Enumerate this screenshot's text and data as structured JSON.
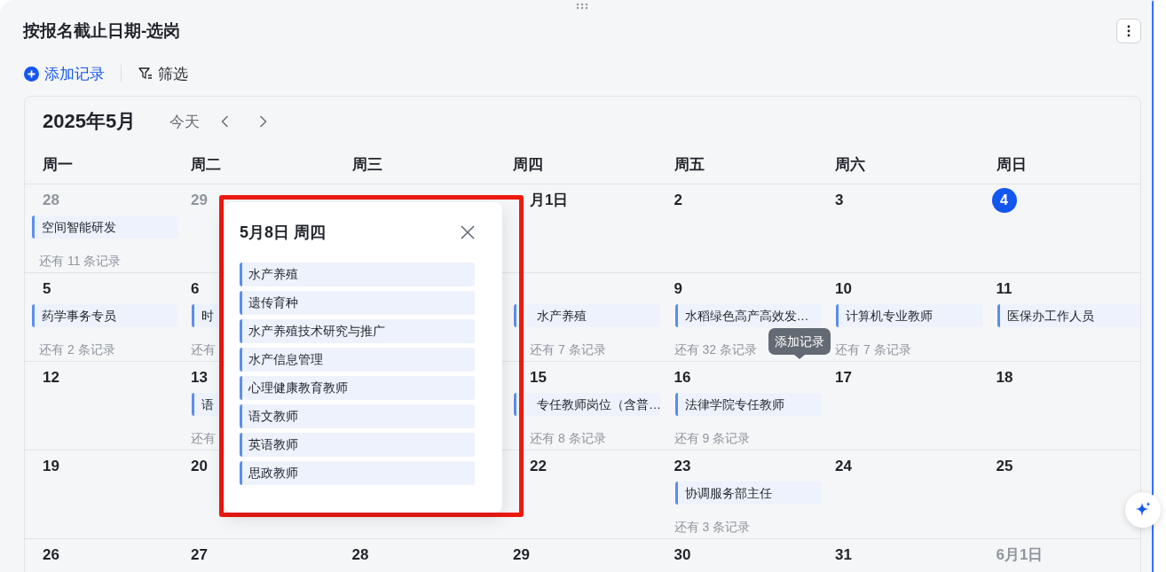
{
  "title": "按报名截止日期-选岗",
  "toolbar": {
    "add_label": "添加记录",
    "filter_label": "筛选"
  },
  "calendar": {
    "month_label": "2025年5月",
    "today_label": "今天",
    "weekdays": [
      "周一",
      "周二",
      "周三",
      "周四",
      "周五",
      "周六",
      "周日"
    ],
    "weeks": [
      {
        "days": [
          {
            "kind": "outside",
            "day": "28",
            "events": [
              "空间智能研发"
            ],
            "more": "还有 11 条记录"
          },
          {
            "kind": "outside",
            "day": "29"
          },
          {
            "kind": "covered"
          },
          {
            "kind": "normal",
            "day": "月1日"
          },
          {
            "kind": "normal",
            "day": "2"
          },
          {
            "kind": "normal",
            "day": "3"
          },
          {
            "kind": "today",
            "day": "4"
          }
        ]
      },
      {
        "days": [
          {
            "kind": "normal",
            "day": "5",
            "events": [
              "药学事务专员"
            ],
            "more": "还有 2 条记录"
          },
          {
            "kind": "normal",
            "day": "6",
            "events": [
              "时"
            ],
            "more": "还有"
          },
          {
            "kind": "covered"
          },
          {
            "kind": "covered",
            "events": [
              "水产养殖"
            ],
            "more": "还有 7 条记录"
          },
          {
            "kind": "normal",
            "day": "9",
            "events": [
              "水稻绿色高产高效发…"
            ],
            "more": "还有 32 条记录"
          },
          {
            "kind": "normal",
            "day": "10",
            "events": [
              "计算机专业教师"
            ],
            "more": "还有 7 条记录"
          },
          {
            "kind": "normal",
            "day": "11",
            "events": [
              "医保办工作人员"
            ]
          }
        ]
      },
      {
        "days": [
          {
            "kind": "normal",
            "day": "12"
          },
          {
            "kind": "normal",
            "day": "13",
            "events": [
              "语"
            ],
            "more": "还有"
          },
          {
            "kind": "covered"
          },
          {
            "kind": "normal",
            "day": "15",
            "events": [
              "专任教师岗位（含普…"
            ],
            "more": "还有 8 条记录"
          },
          {
            "kind": "normal",
            "day": "16",
            "events": [
              "法律学院专任教师"
            ],
            "more": "还有 9 条记录"
          },
          {
            "kind": "normal",
            "day": "17"
          },
          {
            "kind": "normal",
            "day": "18"
          }
        ]
      },
      {
        "days": [
          {
            "kind": "normal",
            "day": "19"
          },
          {
            "kind": "normal",
            "day": "20"
          },
          {
            "kind": "covered"
          },
          {
            "kind": "normal",
            "day": "22"
          },
          {
            "kind": "normal",
            "day": "23",
            "events": [
              "协调服务部主任"
            ],
            "more": "还有 3 条记录"
          },
          {
            "kind": "normal",
            "day": "24"
          },
          {
            "kind": "normal",
            "day": "25"
          }
        ]
      },
      {
        "days": [
          {
            "kind": "normal",
            "day": "26"
          },
          {
            "kind": "normal",
            "day": "27"
          },
          {
            "kind": "normal",
            "day": "28"
          },
          {
            "kind": "normal",
            "day": "29"
          },
          {
            "kind": "normal",
            "day": "30"
          },
          {
            "kind": "normal",
            "day": "31"
          },
          {
            "kind": "outside",
            "day": "6月1日"
          }
        ]
      }
    ]
  },
  "popup": {
    "title": "5月8日 周四",
    "items": [
      "水产养殖",
      "遗传育种",
      "水产养殖技术研究与推广",
      "水产信息管理",
      "心理健康教育教师",
      "语文教师",
      "英语教师",
      "思政教师"
    ]
  },
  "tooltip": {
    "text": "添加记录"
  }
}
